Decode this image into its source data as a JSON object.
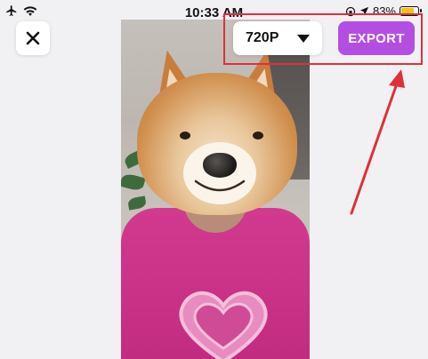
{
  "status_bar": {
    "time": "10:33 AM",
    "battery_percent": "83%",
    "icons": [
      "airplane-icon",
      "wifi-icon",
      "orientation-lock-icon",
      "location-icon",
      "battery-icon"
    ]
  },
  "toolbar": {
    "close_icon": "close-icon",
    "quality_value": "720P",
    "export_label": "EXPORT"
  },
  "colors": {
    "export_button": "#b44ee2",
    "annotation": "#e0303a",
    "background": "#f1f1f3"
  },
  "preview": {
    "content": "dog-face-filter-video"
  }
}
